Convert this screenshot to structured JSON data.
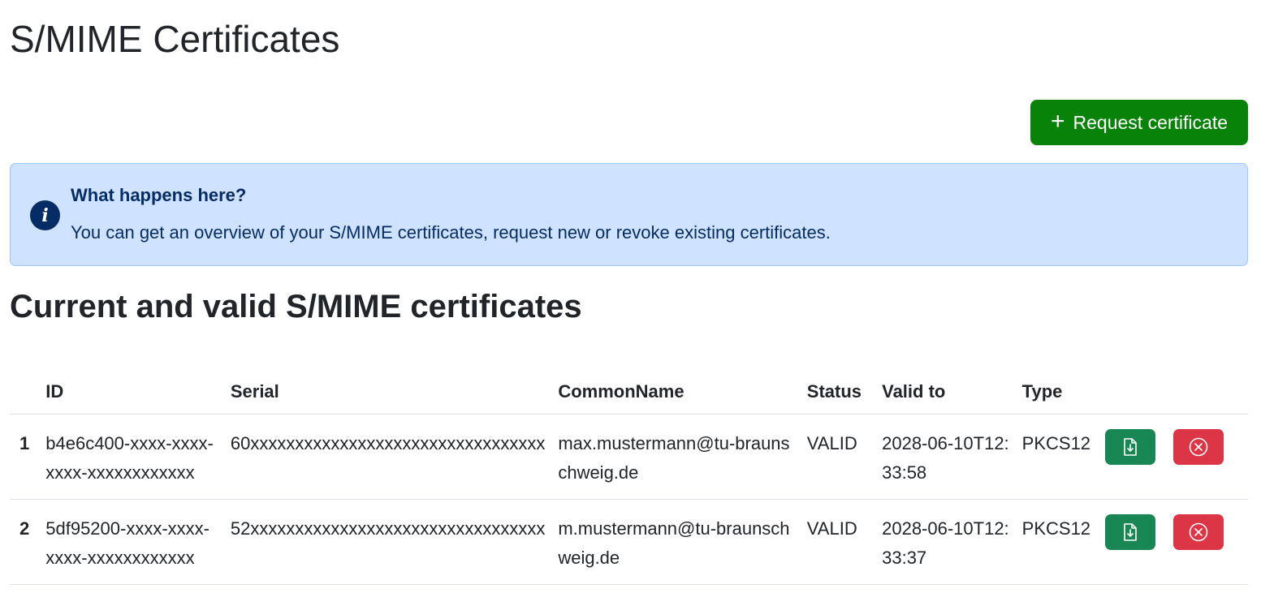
{
  "page": {
    "title": "S/MIME Certificates",
    "request_button_label": "Request certificate"
  },
  "info": {
    "heading": "What happens here?",
    "text": "You can get an overview of your S/MIME certificates, request new or revoke existing certificates.",
    "icon": "info-icon"
  },
  "section": {
    "title": "Current and valid S/MIME certificates"
  },
  "table": {
    "headers": {
      "num": "",
      "id": "ID",
      "serial": "Serial",
      "cn": "CommonName",
      "status": "Status",
      "valid_to": "Valid to",
      "type": "Type"
    },
    "rows": [
      {
        "num": "1",
        "id": "b4e6c400-xxxx-xxxx-xxxx-xxxxxxxxxxxx",
        "serial": "60xxxxxxxxxxxxxxxxxxxxxxxxxxxxxxxxx",
        "cn": "max.mustermann@tu-braunschweig.de",
        "status": "VALID",
        "valid_to": "2028-06-10T12:33:58",
        "type": "PKCS12"
      },
      {
        "num": "2",
        "id": "5df95200-xxxx-xxxx-xxxx-xxxxxxxxxxxx",
        "serial": "52xxxxxxxxxxxxxxxxxxxxxxxxxxxxxxxxx",
        "cn": "m.mustermann@tu-braunschweig.de",
        "status": "VALID",
        "valid_to": "2028-06-10T12:33:37",
        "type": "PKCS12"
      }
    ]
  },
  "colors": {
    "request_button": "#088208",
    "download_button": "#198754",
    "revoke_button": "#dc3545",
    "alert_background": "#cfe2ff",
    "alert_text": "#052c65"
  }
}
